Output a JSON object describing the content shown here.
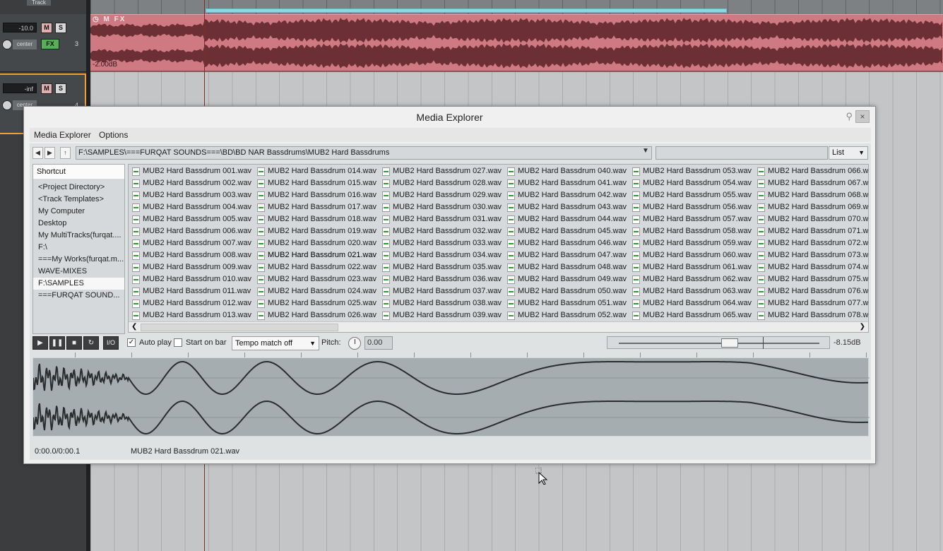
{
  "daw": {
    "track3": {
      "volume": "-10.0",
      "pan": "center",
      "number": "3",
      "item_volume": "-2.00dB"
    },
    "track4": {
      "volume": "-inf",
      "pan": "center",
      "number": "4"
    },
    "top_label": "Track",
    "mute_label": "M",
    "solo_label": "S",
    "fx_label": "FX"
  },
  "media_explorer": {
    "title": "Media Explorer",
    "menu": [
      "Media Explorer",
      "Options"
    ],
    "path": "F:\\SAMPLES\\===FURQAT SOUNDS===\\BD\\BD NAR  Bassdrums\\MUB2 Hard Bassdrums",
    "search_value": "",
    "view_mode": "List",
    "shortcut_header": "Shortcut",
    "shortcuts": [
      "<Project Directory>",
      "<Track Templates>",
      "My Computer",
      "Desktop",
      "My MultiTracks(furqat....",
      "F:\\",
      "===My Works(furqat.m...",
      "WAVE-MIXES",
      "F:\\SAMPLES",
      "===FURQAT SOUND..."
    ],
    "selected_shortcut": 8,
    "files": [
      [
        "MUB2 Hard Bassdrum 001.wav",
        "MUB2 Hard Bassdrum 002.wav",
        "MUB2 Hard Bassdrum 003.wav",
        "MUB2 Hard Bassdrum 004.wav",
        "MUB2 Hard Bassdrum 005.wav",
        "MUB2 Hard Bassdrum 006.wav",
        "MUB2 Hard Bassdrum 007.wav",
        "MUB2 Hard Bassdrum 008.wav",
        "MUB2 Hard Bassdrum 009.wav",
        "MUB2 Hard Bassdrum 010.wav",
        "MUB2 Hard Bassdrum 011.wav",
        "MUB2 Hard Bassdrum 012.wav",
        "MUB2 Hard Bassdrum 013.wav"
      ],
      [
        "MUB2 Hard Bassdrum 014.wav",
        "MUB2 Hard Bassdrum 015.wav",
        "MUB2 Hard Bassdrum 016.wav",
        "MUB2 Hard Bassdrum 017.wav",
        "MUB2 Hard Bassdrum 018.wav",
        "MUB2 Hard Bassdrum 019.wav",
        "MUB2 Hard Bassdrum 020.wav",
        "MUB2 Hard Bassdrum 021.wav",
        "MUB2 Hard Bassdrum 022.wav",
        "MUB2 Hard Bassdrum 023.wav",
        "MUB2 Hard Bassdrum 024.wav",
        "MUB2 Hard Bassdrum 025.wav",
        "MUB2 Hard Bassdrum 026.wav"
      ],
      [
        "MUB2 Hard Bassdrum 027.wav",
        "MUB2 Hard Bassdrum 028.wav",
        "MUB2 Hard Bassdrum 029.wav",
        "MUB2 Hard Bassdrum 030.wav",
        "MUB2 Hard Bassdrum 031.wav",
        "MUB2 Hard Bassdrum 032.wav",
        "MUB2 Hard Bassdrum 033.wav",
        "MUB2 Hard Bassdrum 034.wav",
        "MUB2 Hard Bassdrum 035.wav",
        "MUB2 Hard Bassdrum 036.wav",
        "MUB2 Hard Bassdrum 037.wav",
        "MUB2 Hard Bassdrum 038.wav",
        "MUB2 Hard Bassdrum 039.wav"
      ],
      [
        "MUB2 Hard Bassdrum 040.wav",
        "MUB2 Hard Bassdrum 041.wav",
        "MUB2 Hard Bassdrum 042.wav",
        "MUB2 Hard Bassdrum 043.wav",
        "MUB2 Hard Bassdrum 044.wav",
        "MUB2 Hard Bassdrum 045.wav",
        "MUB2 Hard Bassdrum 046.wav",
        "MUB2 Hard Bassdrum 047.wav",
        "MUB2 Hard Bassdrum 048.wav",
        "MUB2 Hard Bassdrum 049.wav",
        "MUB2 Hard Bassdrum 050.wav",
        "MUB2 Hard Bassdrum 051.wav",
        "MUB2 Hard Bassdrum 052.wav"
      ],
      [
        "MUB2 Hard Bassdrum 053.wav",
        "MUB2 Hard Bassdrum 054.wav",
        "MUB2 Hard Bassdrum 055.wav",
        "MUB2 Hard Bassdrum 056.wav",
        "MUB2 Hard Bassdrum 057.wav",
        "MUB2 Hard Bassdrum 058.wav",
        "MUB2 Hard Bassdrum 059.wav",
        "MUB2 Hard Bassdrum 060.wav",
        "MUB2 Hard Bassdrum 061.wav",
        "MUB2 Hard Bassdrum 062.wav",
        "MUB2 Hard Bassdrum 063.wav",
        "MUB2 Hard Bassdrum 064.wav",
        "MUB2 Hard Bassdrum 065.wav"
      ],
      [
        "MUB2 Hard Bassdrum 066.wav",
        "MUB2 Hard Bassdrum 067.wav",
        "MUB2 Hard Bassdrum 068.wav",
        "MUB2 Hard Bassdrum 069.wav",
        "MUB2 Hard Bassdrum 070.wav",
        "MUB2 Hard Bassdrum 071.wav",
        "MUB2 Hard Bassdrum 072.wav",
        "MUB2 Hard Bassdrum 073.wav",
        "MUB2 Hard Bassdrum 074.wav",
        "MUB2 Hard Bassdrum 075.wav",
        "MUB2 Hard Bassdrum 076.wav",
        "MUB2 Hard Bassdrum 077.wav",
        "MUB2 Hard Bassdrum 078.wav"
      ]
    ],
    "selected_file": "MUB2 Hard Bassdrum 021.wav",
    "transport": {
      "io_label": "I/O",
      "auto_play_label": "Auto play",
      "auto_play_checked": true,
      "start_on_bar_label": "Start on bar",
      "start_on_bar_checked": false,
      "tempo_match": "Tempo match off",
      "pitch_label": "Pitch:",
      "pitch_value": "0.00",
      "volume_value": "-8.15dB"
    },
    "status": {
      "time": "0:00.0/0:00.1",
      "file": "MUB2 Hard Bassdrum 021.wav"
    }
  },
  "icons": [
    "pin-icon",
    "close-icon",
    "back-icon",
    "forward-icon",
    "up-folder-icon",
    "dropdown-arrow-icon",
    "play-icon",
    "pause-icon",
    "stop-icon",
    "repeat-icon",
    "wave-file-icon",
    "mouse-cursor-icon"
  ],
  "colors": {
    "track_item": "#cf7a83",
    "loop_region": "#8ed8e6",
    "waveform_bg": "#a6adb0"
  }
}
